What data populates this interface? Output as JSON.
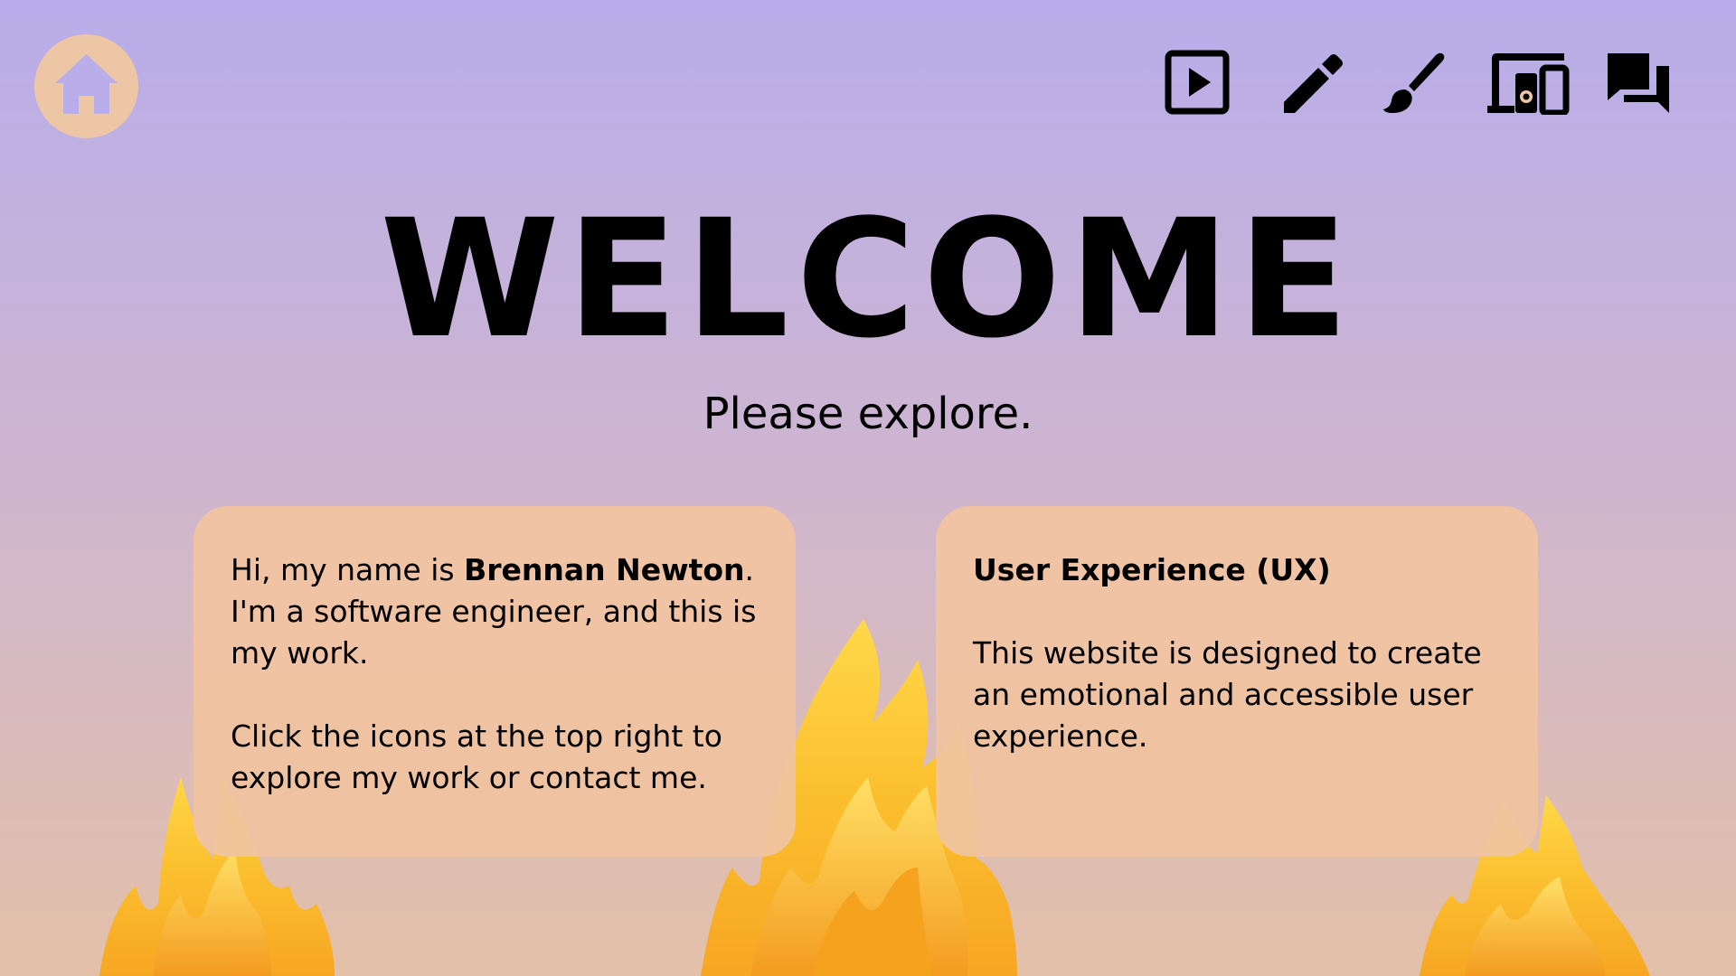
{
  "colors": {
    "background_top": "#b8adea",
    "background_bottom": "#e3c0a8",
    "card_background": "#f0c4a0",
    "home_circle": "#edc6a6",
    "home_house": "#b9adea",
    "icon_color": "#000000"
  },
  "nav": {
    "home_icon": "home-icon",
    "icons": [
      "play-icon",
      "pencil-icon",
      "paintbrush-icon",
      "devices-icon",
      "chat-icon"
    ]
  },
  "hero": {
    "title": "WELCOME",
    "subtitle": "Please explore."
  },
  "intro_card": {
    "greeting_prefix": "Hi, my name is ",
    "name": "Brennan Newton",
    "greeting_suffix": ". I'm a software engineer, and this is my work.",
    "instructions": "Click the icons at the top right to explore my work or contact me."
  },
  "ux_card": {
    "heading": "User Experience (UX)",
    "body": "This website is designed to create an emotional and accessible user experience."
  }
}
